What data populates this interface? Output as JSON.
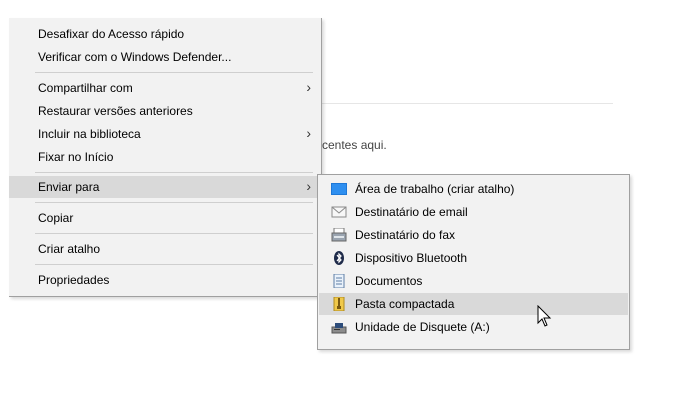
{
  "background": {
    "hint_text": "centes aqui."
  },
  "context_menu": {
    "items": [
      {
        "label": "Desafixar do Acesso rápido"
      },
      {
        "label": "Verificar com o Windows Defender..."
      },
      {
        "label": "Compartilhar com",
        "arrow": "›"
      },
      {
        "label": "Restaurar versões anteriores"
      },
      {
        "label": "Incluir na biblioteca",
        "arrow": "›"
      },
      {
        "label": "Fixar no Início"
      },
      {
        "label": "Enviar para",
        "arrow": "›"
      },
      {
        "label": "Copiar"
      },
      {
        "label": "Criar atalho"
      },
      {
        "label": "Propriedades"
      }
    ]
  },
  "send_to_menu": {
    "items": [
      {
        "label": "Área de trabalho (criar atalho)",
        "icon": "desktop-icon"
      },
      {
        "label": "Destinatário de email",
        "icon": "mail-icon"
      },
      {
        "label": "Destinatário do fax",
        "icon": "fax-icon"
      },
      {
        "label": "Dispositivo Bluetooth",
        "icon": "bluetooth-icon"
      },
      {
        "label": "Documentos",
        "icon": "documents-icon"
      },
      {
        "label": "Pasta compactada",
        "icon": "zip-folder-icon"
      },
      {
        "label": "Unidade de Disquete (A:)",
        "icon": "floppy-drive-icon"
      }
    ]
  },
  "colors": {
    "menu_bg": "#f2f2f2",
    "highlight": "#d9d9d9",
    "border": "#a0a0a0"
  }
}
